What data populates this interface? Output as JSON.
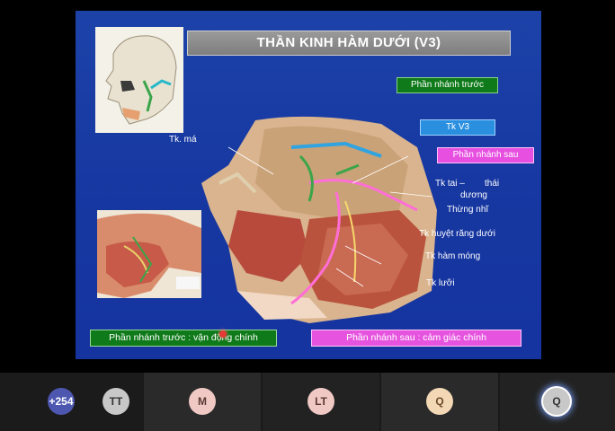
{
  "slide": {
    "title": "THẦN KINH HÀM DƯỚI (V3)",
    "labels": {
      "tk_ma": "Tk. má",
      "anterior_branch": "Phần nhánh trước",
      "tk_v3": "Tk V3",
      "posterior_branch": "Phần nhánh sau",
      "auriculotemporal_1": "Tk tai –",
      "auriculotemporal_2": "thái",
      "auriculotemporal_3": "dương",
      "chorda_tympani": "Thừng nhĩ",
      "inferior_alveolar": "Tk huyệt răng dưới",
      "mylohyoid": "Tk hàm móng",
      "lingual": "Tk lưỡi"
    },
    "footer_anterior": "Phần nhánh trước : vận động chính",
    "footer_posterior": "Phần nhánh sau : cảm giác chính",
    "colors": {
      "green": "#0f7a1a",
      "blue": "#2b8fe0",
      "pink": "#e64fe0",
      "slide_bg": "#1a3ea0"
    }
  },
  "participants": {
    "overflow_count": "+254",
    "tiles": [
      {
        "initials": "TT",
        "color": "#c8c8c8"
      },
      {
        "initials": "M",
        "color": "#f0c9c4"
      },
      {
        "initials": "LT",
        "color": "#f0c9c4"
      },
      {
        "initials": "Q",
        "color": "#f3d8b6"
      },
      {
        "initials": "Q",
        "color": "#c8c8c8",
        "active": true
      }
    ]
  }
}
